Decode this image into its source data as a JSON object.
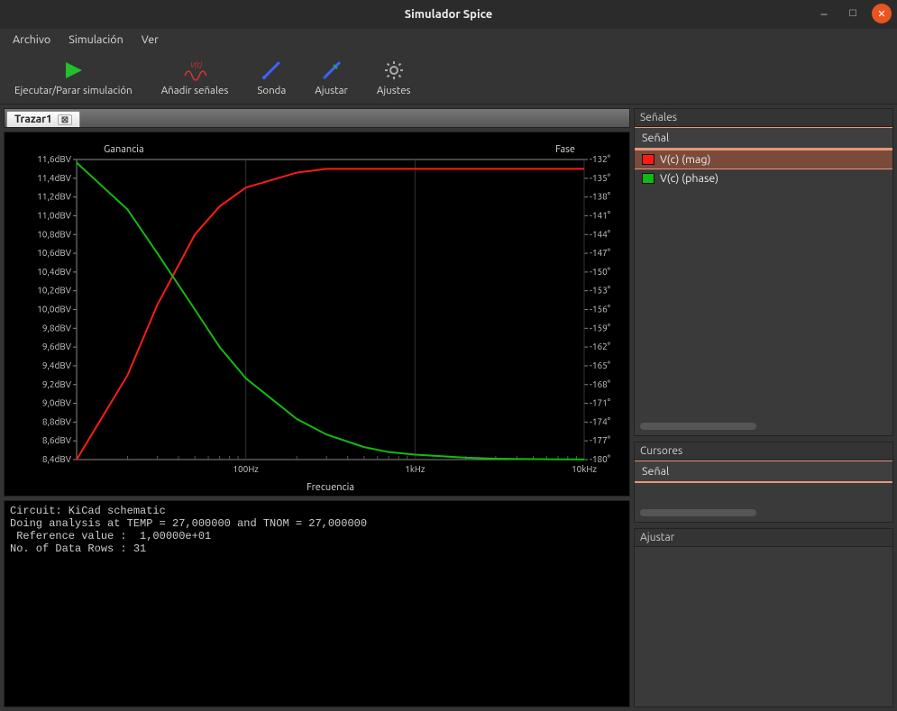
{
  "window": {
    "title": "Simulador Spice"
  },
  "menu": {
    "items": [
      "Archivo",
      "Simulación",
      "Ver"
    ]
  },
  "toolbar": {
    "run": {
      "label": "Ejecutar/Parar simulación"
    },
    "add": {
      "label": "Añadir señales"
    },
    "probe": {
      "label": "Sonda"
    },
    "tune": {
      "label": "Ajustar"
    },
    "prefs": {
      "label": "Ajustes"
    }
  },
  "tabs": [
    {
      "label": "Trazar1"
    }
  ],
  "plot": {
    "left_title": "Ganancia",
    "right_title": "Fase",
    "x_label": "Frecuencia",
    "y_left_ticks": [
      "11,6dBV",
      "11,4dBV",
      "11,2dBV",
      "11,0dBV",
      "10,8dBV",
      "10,6dBV",
      "10,4dBV",
      "10,2dBV",
      "10,0dBV",
      "9,8dBV",
      "9,6dBV",
      "9,4dBV",
      "9,2dBV",
      "9,0dBV",
      "8,8dBV",
      "8,6dBV",
      "8,4dBV"
    ],
    "y_right_ticks": [
      "-132°",
      "-135°",
      "-138°",
      "-141°",
      "-144°",
      "-147°",
      "-150°",
      "-153°",
      "-156°",
      "-159°",
      "-162°",
      "-165°",
      "-168°",
      "-171°",
      "-174°",
      "-177°",
      "-180°"
    ],
    "x_ticks": [
      "100Hz",
      "1kHz",
      "10kHz"
    ]
  },
  "signals_panel": {
    "title": "Señales",
    "header": "Señal",
    "items": [
      {
        "label": "V(c) (mag)",
        "color": "#ff1a1a",
        "selected": true
      },
      {
        "label": "V(c) (phase)",
        "color": "#12b912",
        "selected": false
      }
    ]
  },
  "cursors_panel": {
    "title": "Cursores",
    "header": "Señal"
  },
  "adjust_panel": {
    "title": "Ajustar"
  },
  "console_lines": [
    "Circuit: KiCad schematic",
    "Doing analysis at TEMP = 27,000000 and TNOM = 27,000000",
    " Reference value :  1,00000e+01",
    "No. of Data Rows : 31"
  ],
  "chart_data": {
    "type": "line",
    "xlabel": "Frecuencia",
    "x_scale": "log",
    "x": [
      10,
      20,
      30,
      50,
      70,
      100,
      200,
      300,
      500,
      700,
      1000,
      2000,
      3000,
      5000,
      7000,
      10000
    ],
    "series": [
      {
        "name": "V(c) (mag)",
        "axis": "left",
        "ylabel": "Ganancia",
        "unit": "dBV",
        "ylim": [
          8.4,
          11.6
        ],
        "color": "#ff1a1a",
        "values": [
          8.4,
          9.3,
          10.05,
          10.8,
          11.1,
          11.3,
          11.46,
          11.5,
          11.5,
          11.5,
          11.5,
          11.5,
          11.5,
          11.5,
          11.5,
          11.5
        ]
      },
      {
        "name": "V(c) (phase)",
        "axis": "right",
        "ylabel": "Fase",
        "unit": "deg",
        "ylim": [
          -180,
          -132
        ],
        "color": "#12b912",
        "values": [
          -132.5,
          -140.0,
          -147.0,
          -156.0,
          -162.0,
          -167.0,
          -173.5,
          -176.0,
          -178.0,
          -178.8,
          -179.2,
          -179.7,
          -179.85,
          -179.93,
          -179.96,
          -179.98
        ]
      }
    ]
  }
}
